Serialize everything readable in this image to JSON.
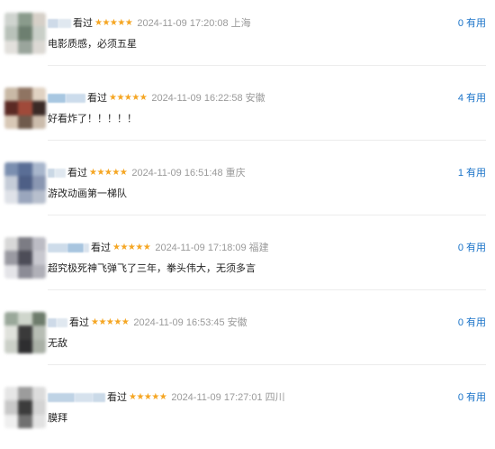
{
  "watched_label": "看过",
  "useful_label": "有用",
  "colors": {
    "star": "#f5a623",
    "useful": "#1a73c8",
    "meta": "#9a9a9a"
  },
  "comments": [
    {
      "stars": "★★★★★",
      "time": "2024-11-09 17:20:08",
      "region": "上海",
      "content": "电影质感，必须五星",
      "useful_count": "0",
      "avatar_colors": [
        "#cfd4cf",
        "#8a9b8c",
        "#d6d0c8",
        "#b9c2ba",
        "#6d7f70",
        "#c9cfc8",
        "#e2e0dc",
        "#9aa59c",
        "#dcd9d4"
      ],
      "name_colors": [
        "#c9d7e6",
        "#dde6ef"
      ]
    },
    {
      "stars": "★★★★★",
      "time": "2024-11-09 16:22:58",
      "region": "安徽",
      "content": "好看炸了！！！！！",
      "useful_count": "4",
      "avatar_colors": [
        "#c9b9a6",
        "#8f7462",
        "#e0d2c2",
        "#5b2a24",
        "#a04a3a",
        "#3a2a26",
        "#d8c8b6",
        "#6f5a4c",
        "#cbbcac"
      ],
      "name_colors": [
        "#9fc2de",
        "#c7d9ea"
      ]
    },
    {
      "stars": "★★★★★",
      "time": "2024-11-09 16:51:48",
      "region": "重庆",
      "content": "游改动画第一梯队",
      "useful_count": "1",
      "avatar_colors": [
        "#7b8fb0",
        "#5a6e96",
        "#a8b6cc",
        "#c5ccd8",
        "#4e5f86",
        "#8a97b2",
        "#dfe2e8",
        "#9aa6bd",
        "#b7bfcd"
      ],
      "name_colors": [
        "#c5d4e3",
        "#dde6ef"
      ]
    },
    {
      "stars": "★★★★★",
      "time": "2024-11-09 17:18:09",
      "region": "福建",
      "content": "超究极死神飞弹飞了三年，拳头伟大，无须多言",
      "useful_count": "0",
      "avatar_colors": [
        "#d8d8d8",
        "#7c7c84",
        "#bcbcc4",
        "#9a9aa2",
        "#4d4d58",
        "#c8c8cf",
        "#e4e4e8",
        "#8c8c96",
        "#b0b0b8"
      ],
      "name_colors": [
        "#c9d9e8",
        "#9fbfdc",
        "#d6e1ec"
      ]
    },
    {
      "stars": "★★★★★",
      "time": "2024-11-09 16:53:45",
      "region": "安徽",
      "content": "无敌",
      "useful_count": "0",
      "avatar_colors": [
        "#9aa89a",
        "#cfd6cc",
        "#6e7c6c",
        "#e0e2dc",
        "#3a3a3a",
        "#b7bdb4",
        "#cbd0c8",
        "#2e2e30",
        "#a9b0a6"
      ],
      "name_colors": [
        "#c9d7e6",
        "#dde6ef"
      ]
    },
    {
      "stars": "★★★★★",
      "time": "2024-11-09 17:27:01",
      "region": "四川",
      "content": "膜拜",
      "useful_count": "0",
      "avatar_colors": [
        "#e6e6e6",
        "#9c9c9c",
        "#dcdcdc",
        "#c8c8c8",
        "#3c3c3c",
        "#d4d4d4",
        "#efefef",
        "#707070",
        "#e2e2e2"
      ],
      "name_colors": [
        "#b9cfe3",
        "#d2dfec",
        "#c5d6e6"
      ]
    }
  ]
}
